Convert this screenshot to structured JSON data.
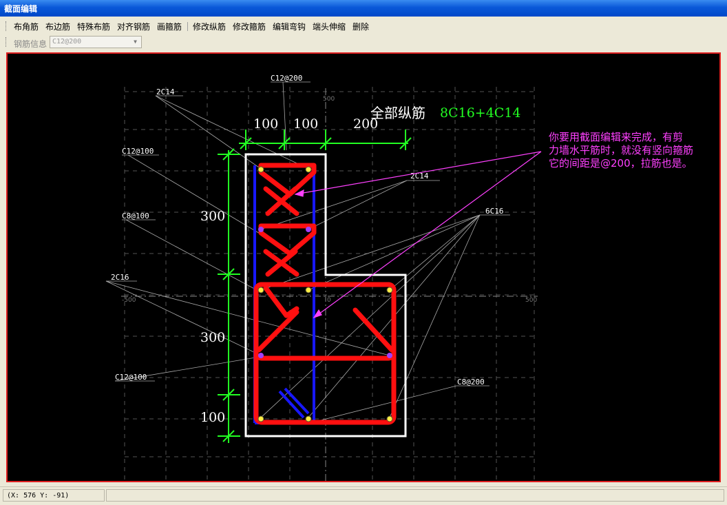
{
  "window": {
    "title": "截面编辑"
  },
  "toolbar": {
    "items": [
      "布角筋",
      "布边筋",
      "特殊布筋",
      "对齐钢筋",
      "画箍筋",
      "修改纵筋",
      "修改箍筋",
      "编辑弯钩",
      "端头伸缩",
      "删除"
    ]
  },
  "toolbar2": {
    "label": "钢筋信息",
    "combo_value": "C12@200"
  },
  "drawing": {
    "axis_labels": {
      "y_top": "500",
      "x_left": "-500",
      "origin": "0",
      "x_right": "500"
    },
    "dims": {
      "top_1": "100",
      "top_2": "100",
      "top_3": "200",
      "left_1": "300",
      "left_2": "300",
      "left_3": "100"
    },
    "summary": {
      "label": "全部纵筋",
      "value": "8C16+4C14"
    },
    "leader_labels": {
      "2c14_a": "2C14",
      "c12_200_top": "C12@200",
      "c12_100_a": "C12@100",
      "c8_100": "C8@100",
      "2c14_b": "2C14",
      "6c16": "6C16",
      "2c16": "2C16",
      "c12_100_b": "C12@100",
      "c8_200": "C8@200"
    },
    "annotation": {
      "line1": "你要用截面编辑来完成，有剪",
      "line2": "力墙水平筋时，就没有竖向箍筋",
      "line3": "它的间距是@200，拉筋也是。"
    },
    "colors": {
      "background": "#000000",
      "outline": "#ffffff",
      "stirrup": "#ff1010",
      "tie": "#1010ff",
      "dimension": "#22ff22",
      "annotation": "#ff40ff"
    }
  },
  "status": {
    "coords": "(X: 576 Y: -91)"
  }
}
